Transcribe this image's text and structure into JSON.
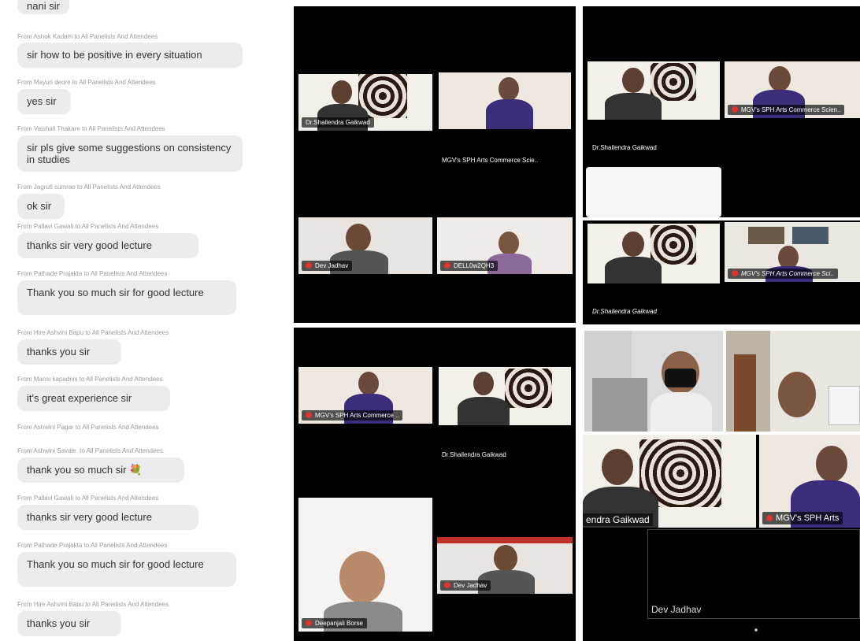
{
  "chat": {
    "messages": [
      {
        "from": "",
        "text": "nani sir"
      },
      {
        "from": "From Ashok Kadam to All Panelists And Attendees",
        "text": "sir how to be positive in every situation"
      },
      {
        "from": "From Mayuri deore to All Panelists And Attendees",
        "text": "yes sir"
      },
      {
        "from": "From Vaishali Thakare to All Panelists And Attendees",
        "text": "sir pls give some suggestions on consistency in studies"
      },
      {
        "from": "From Jagruti sumrao to All Panelists And Attendees",
        "text": "ok sir"
      },
      {
        "from": "From Pallavi Gawali to All Panelists And Attendees",
        "text": "thanks sir very good lecture"
      },
      {
        "from": "From Pathade Prajakta to All Panelists And Attendees",
        "text": "Thank you so much sir for good lecture"
      },
      {
        "from": "From Hire Ashvini Bapu to All Panelists And Attendees",
        "text": "thanks you sir"
      },
      {
        "from": "From Mansi kapadnis to All Panelists And Attendees",
        "text": "it's great experience sir"
      },
      {
        "from": "From Ashwini Pagar to All Panelists And Attendees",
        "text": ""
      },
      {
        "from": "From Ashwini Savale. to All Panelists And Attendees",
        "text": "thank you so much sir 💐"
      },
      {
        "from": "From Pallavi Gawali to All Panelists And Attendees",
        "text": "thanks sir very good lecture"
      },
      {
        "from": "From Pathade Prajakta to All Panelists And Attendees",
        "text": "Thank you so much sir for good lecture"
      },
      {
        "from": "From Hire Ashvini Bapu to All Panelists And Attendees",
        "text": "thanks you sir"
      }
    ]
  },
  "panels": {
    "p1": {
      "tiles": [
        "Dr.Shailendra Gaikwad",
        "MGV's SPH Arts Commerce Scie..",
        "Dev Jadhav",
        "DELL0w2QH3"
      ]
    },
    "p2": {
      "tiles": [
        "MGV's SPH Arts Commerce ..",
        "Dr.Shailendra Gaikwad",
        "Deepanjali Borse",
        "Dev Jadhav"
      ]
    },
    "p3": {
      "tiles": [
        "Dr.Shailendra Gaikwad",
        "MGV's SPH Arts Commerce Scien.."
      ]
    },
    "p4": {
      "tiles": [
        "Dr.Shailendra Gaikwad",
        "MGV's SPH Arts Commerce Sci.."
      ]
    },
    "p6": {
      "tiles": [
        "endra Gaikwad",
        "MGV's SPH Arts",
        "Dev Jadhav"
      ]
    }
  },
  "colors": {
    "active_border": "#1fa84a",
    "bubble": "#ececef"
  }
}
